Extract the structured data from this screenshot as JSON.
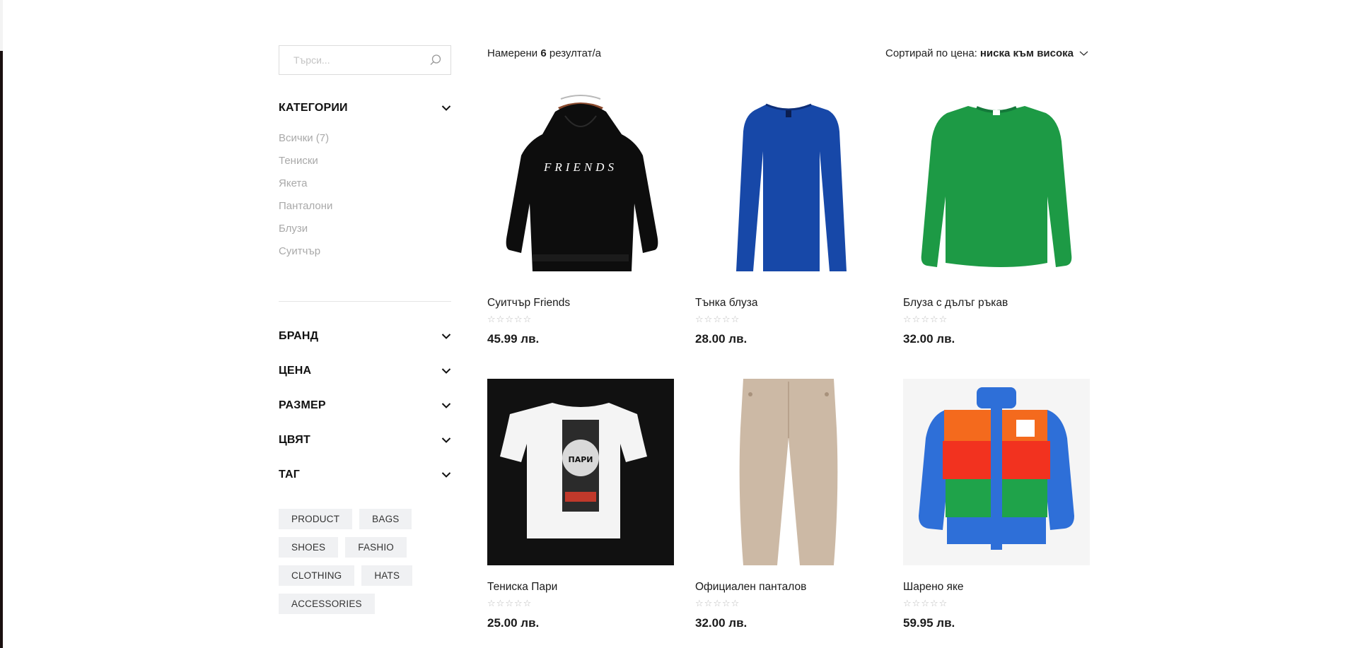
{
  "search": {
    "placeholder": "Търси..."
  },
  "categories": {
    "title": "КАТЕГОРИИ",
    "items": [
      "Всички (7)",
      "Тениски",
      "Якета",
      "Панталони",
      "Блузи",
      "Суитчър"
    ]
  },
  "filters": [
    {
      "title": "БРАНД"
    },
    {
      "title": "ЦЕНА"
    },
    {
      "title": "РАЗМЕР"
    },
    {
      "title": "ЦВЯТ"
    },
    {
      "title": "ТАГ"
    }
  ],
  "tags": [
    "PRODUCT",
    "BAGS",
    "SHOES",
    "FASHIO",
    "CLOTHING",
    "HATS",
    "ACCESSORIES"
  ],
  "results": {
    "prefix": "Намерени",
    "count": "6",
    "suffix": "резултат/а"
  },
  "sort": {
    "label": "Сортирай по цена:",
    "value": "ниска към висока"
  },
  "products": [
    {
      "name": "Суитчър Friends",
      "price": "45.99 лв.",
      "image": "black-hoodie-friends",
      "print": "FRIENDS"
    },
    {
      "name": "Тънка блуза",
      "price": "28.00 лв.",
      "image": "blue-long-sleeve-top"
    },
    {
      "name": "Блуза с дълъг ръкав",
      "price": "32.00 лв.",
      "image": "green-sweatshirt"
    },
    {
      "name": "Тениска Пари",
      "price": "25.00 лв.",
      "image": "white-tshirt-print",
      "print": "ПАРИ"
    },
    {
      "name": "Официален панталов",
      "price": "32.00 лв.",
      "image": "beige-trousers"
    },
    {
      "name": "Шарено яке",
      "price": "59.95 лв.",
      "image": "colorblock-puffer-jacket"
    }
  ],
  "colors": {
    "accent": "#111111",
    "muted": "#a9a9a9",
    "tag_bg": "#f0f1f3",
    "star": "#bdbdbd"
  }
}
